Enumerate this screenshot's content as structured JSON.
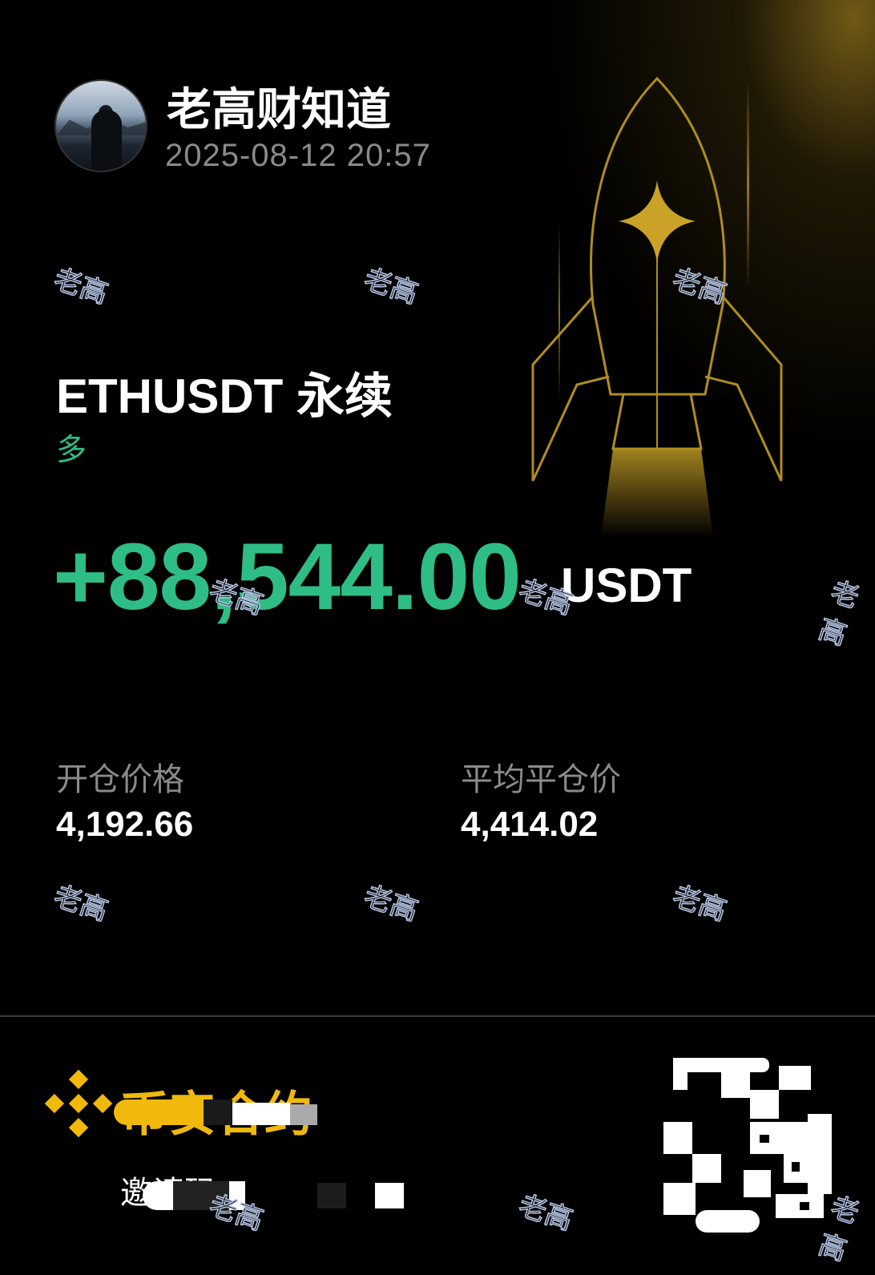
{
  "header": {
    "username": "老高财知道",
    "timestamp": "2025-08-12 20:57",
    "avatar_icon": "profile-photo"
  },
  "position": {
    "pair": "ETHUSDT 永续",
    "side": "多",
    "pnl": "+88,544.00",
    "pnl_unit": "USDT",
    "side_color": "#2ebd85"
  },
  "stats": {
    "entry_label": "开仓价格",
    "entry_value": "4,192.66",
    "close_label": "平均平仓价",
    "close_value": "4,414.02"
  },
  "footer": {
    "brand": "币安合约",
    "invite_prefix": "邀请码",
    "brand_color": "#f0b90b",
    "logo_icon": "binance-logo-icon",
    "qr_icon": "qr-code-icon"
  },
  "watermark": {
    "text": "老高"
  },
  "decor": {
    "rocket_icon": "rocket-icon",
    "accent": "#c9a227"
  }
}
